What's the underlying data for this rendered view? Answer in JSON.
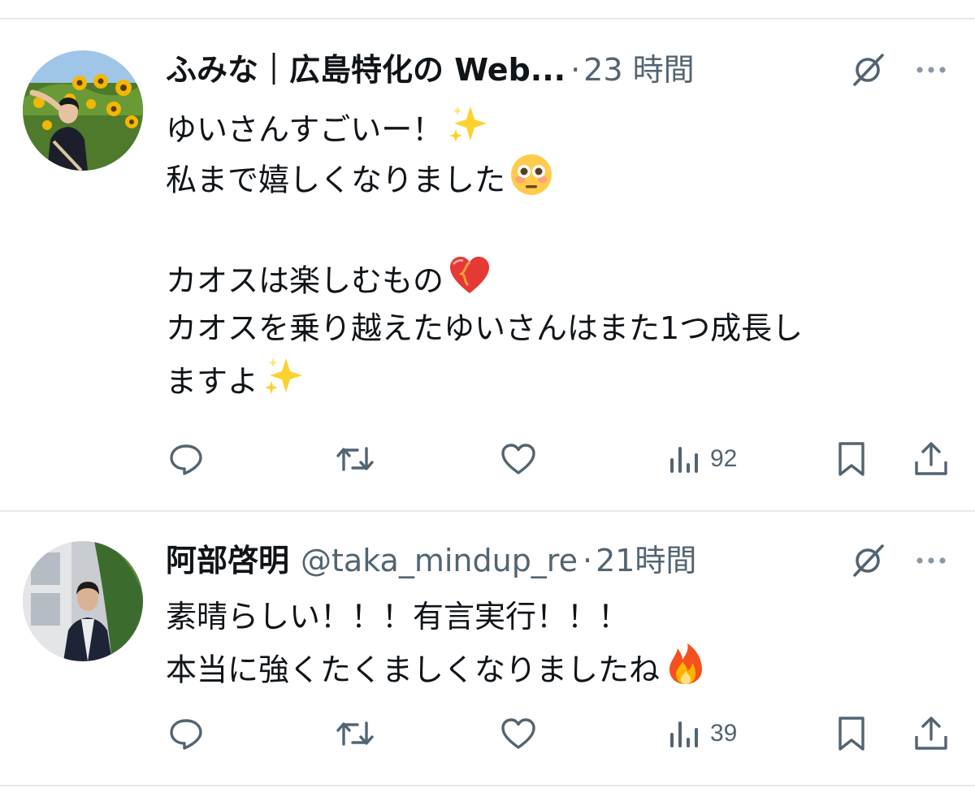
{
  "tweets": [
    {
      "name": "ふみな｜広島特化の Web...",
      "handle": "",
      "dot": "·",
      "time": "23 時間",
      "lines": [
        "ゆいさんすごいー！",
        "私まで嬉しくなりました",
        "",
        "カオスは楽しむもの",
        "カオスを乗り越えたゆいさんはまた1つ成長し",
        "ますよ"
      ],
      "emojis": [
        "sparkles-emoji",
        "flushed-face-emoji",
        "mending-heart-emoji",
        "sparkles-emoji"
      ],
      "views": "92"
    },
    {
      "name": "阿部啓明",
      "handle": "@taka_mindup_re",
      "dot": "·",
      "time": "21時間",
      "lines": [
        "素晴らしい！！！有言実行！！！",
        "本当に強くたくましくなりましたね"
      ],
      "emojis": [
        "fire-emoji"
      ],
      "views": "39"
    }
  ],
  "icons": {
    "reply": "reply-icon",
    "repost": "repost-icon",
    "like": "heart-icon",
    "views": "views-icon",
    "bookmark": "bookmark-icon",
    "share": "share-icon",
    "grok": "grok-icon",
    "more": "more-icon"
  },
  "colors": {
    "text": "#0f1419",
    "secondary": "#536471",
    "divider": "#e6e9ec"
  }
}
